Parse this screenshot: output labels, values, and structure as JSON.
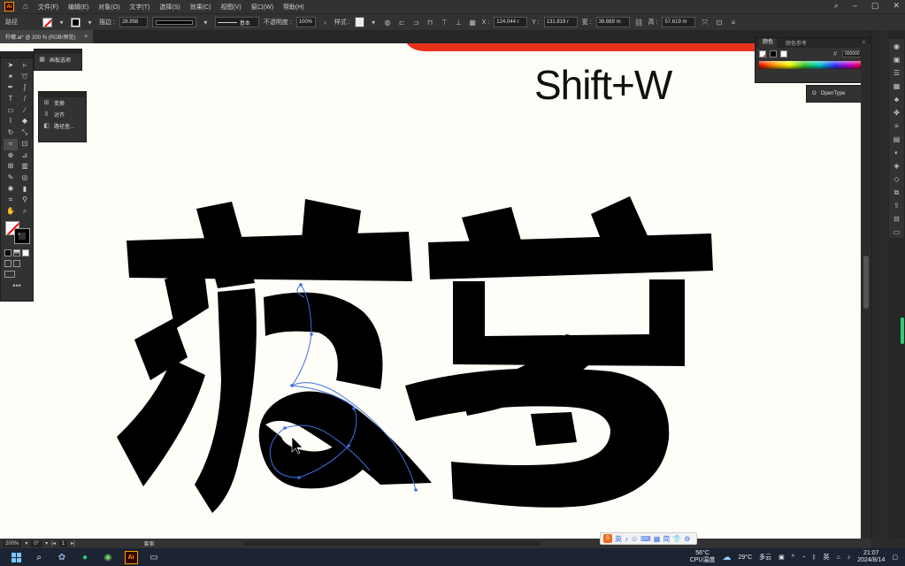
{
  "app": {
    "logo": "Ai",
    "menus": [
      "文件(F)",
      "编辑(E)",
      "对象(O)",
      "文字(T)",
      "选择(S)",
      "效果(C)",
      "视图(V)",
      "窗口(W)",
      "帮助(H)"
    ]
  },
  "controlbar": {
    "object_type": "路径",
    "stroke_label": "描边 :",
    "stroke_value": "28.958",
    "brush_label": "基本",
    "opacity_label": "不透明度 :",
    "opacity_value": "100%",
    "style_label": "样式 :",
    "x_label": "X :",
    "x_value": "124.044 r",
    "y_label": "Y :",
    "y_value": "131.819 r",
    "w_label": "宽 :",
    "w_value": "39.889 m",
    "h_label": "高 :",
    "h_value": "57.619 m"
  },
  "document": {
    "tab_title": "柠檬.ai* @ 200 % (RGB/预览)",
    "close_glyph": "×"
  },
  "canvas": {
    "shortcut_text": "Shift+W"
  },
  "panels": {
    "artboards_label": "画板选项",
    "float_items": [
      "变换",
      "对齐",
      "路径查..."
    ],
    "color_tab": "颜色",
    "color_ref_tab": "颜色参考",
    "hex_value": "000000",
    "opentype_label": "OpenType"
  },
  "status": {
    "zoom": "200%",
    "angle": "0°",
    "artboard_num": "1",
    "tool_name": "套索"
  },
  "ime": {
    "items": [
      "英",
      "♪",
      "☺",
      "⌨",
      "▦",
      "简",
      "👕",
      "⚙"
    ]
  },
  "taskbar": {
    "temp": "56°C",
    "temp_label": "CPU温度",
    "weather_temp": "29°C",
    "weather_desc": "多云",
    "ime_lang": "英",
    "time": "21:07",
    "date": "2024/8/14"
  },
  "colors": {
    "accent_orange": "#ff9a00",
    "path_selection": "#3d6fe0",
    "banner_red": "#e8321e",
    "glyph_fill": "#000000",
    "canvas_bg": "#fffdf7"
  }
}
